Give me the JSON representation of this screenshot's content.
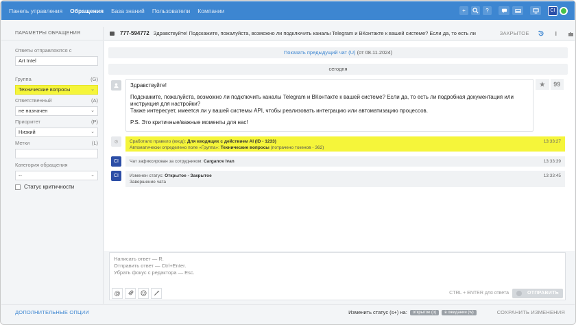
{
  "nav": {
    "links": [
      "Панель управления",
      "Обращения",
      "База знаний",
      "Пользователи",
      "Компании"
    ],
    "active_index": 1,
    "avatar_initials": "CI",
    "accent_color": "#3d86d1"
  },
  "left_panel": {
    "title": "ПАРАМЕТРЫ ОБРАЩЕНИЯ",
    "reply_from": {
      "label": "Ответы отправляются с",
      "value": "Art Intel"
    },
    "group": {
      "label": "Группа",
      "shortcut": "(G)",
      "value": "Технические вопросы"
    },
    "assignee": {
      "label": "Ответственный",
      "shortcut": "(A)",
      "value": "не назначен"
    },
    "priority": {
      "label": "Приоритет",
      "shortcut": "(P)",
      "value": "Низкий"
    },
    "tags": {
      "label": "Метки",
      "shortcut": "(L)",
      "value": ""
    },
    "category": {
      "label": "Категория обращения",
      "value": "--"
    },
    "critical": {
      "label": "Статус критичности",
      "checked": false
    }
  },
  "ticket": {
    "number": "777-594772",
    "subject": "Здравствуйте! Подскажите, пожалуйста, возможно ли подключить каналы Telegram и ВКонтакте к вашей системе? Если да, то есть ли по...",
    "status": "ЗАКРЫТОЕ"
  },
  "chat": {
    "prev_chat_link": "Показать предыдущий чат (U)",
    "prev_chat_date": "(от 08.11.2024)",
    "date_separator": "сегодня",
    "message": {
      "greeting": "Здравствуйте!",
      "body1": "Подскажите, пожалуйста, возможно ли подключить каналы Telegram и ВКонтакте к вашей системе? Если да, то есть ли подробная документация или инструкция для настройки?",
      "body2": "Также интересует, имеется ли у вашей системы API, чтобы реализовать интеграцию или автоматизацию процессов.",
      "ps": "P.S. Это критичные/важные моменты для нас!",
      "quote_icon": "99"
    },
    "events": [
      {
        "line1_prefix": "Сработало правило (вход):",
        "line1_bold": "Для входящих с действием AI (ID - 1233)",
        "line2_prefix": "Автоматически определено поле «Группа»:",
        "line2_bold": "Технические вопросы",
        "line2_suffix": "(потрачено токенов - 362)",
        "time": "13:33:27"
      },
      {
        "avatar": "CI",
        "line1_prefix": "Чат зафиксирован за сотрудником:",
        "line1_bold": "Carganov Ivan",
        "time": "13:33:39"
      },
      {
        "avatar": "CI",
        "line1_prefix": "Изменен статус:",
        "line1_bold": "Открытое - Закрытое",
        "line2": "Завершение чата",
        "time": "13:33:45"
      }
    ]
  },
  "reply": {
    "hint_lines": [
      "Написать ответ — R.",
      "Отправить ответ — Ctrl+Enter.",
      "Убрать фокус с редактора — Esc."
    ],
    "shortcut_hint": "CTRL + ENTER для ответа",
    "send_label": "ОТПРАВИТЬ"
  },
  "footer": {
    "more_options": "ДОПОЛНИТЕЛЬНЫЕ ОПЦИИ",
    "change_status": "Изменить статус (s+) на:",
    "status_open": "открытое (o)",
    "status_waiting": "в ожидании (w)",
    "save": "СОХРАНИТЬ ИЗМЕНЕНИЯ"
  }
}
